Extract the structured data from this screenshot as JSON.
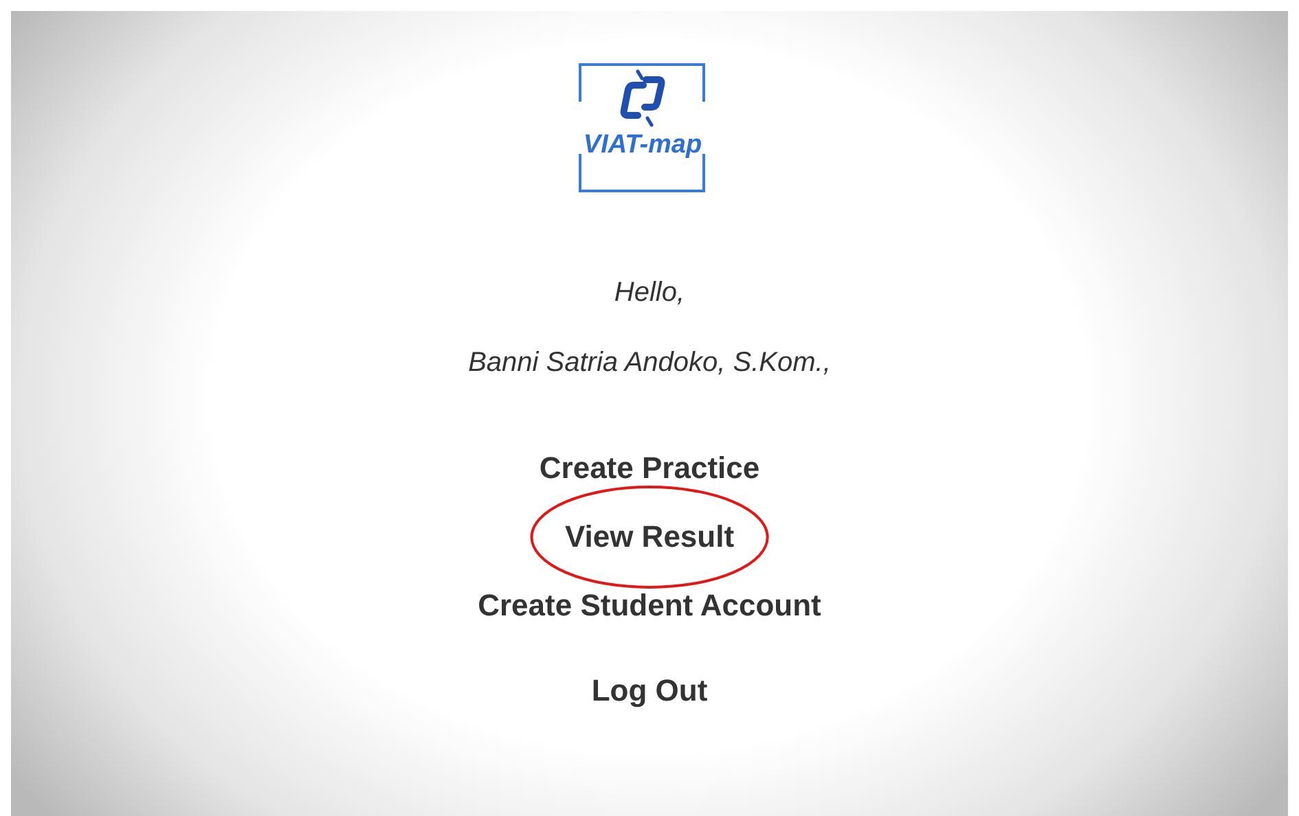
{
  "logo": {
    "text": "VIAT-map"
  },
  "greeting": "Hello,",
  "user_name": "Banni Satria Andoko, S.Kom.,",
  "menu": [
    {
      "label": "Create Practice",
      "circled": false
    },
    {
      "label": "View Result",
      "circled": true
    },
    {
      "label": "Create Student Account",
      "circled": false
    },
    {
      "label": "Log Out",
      "circled": false
    }
  ]
}
